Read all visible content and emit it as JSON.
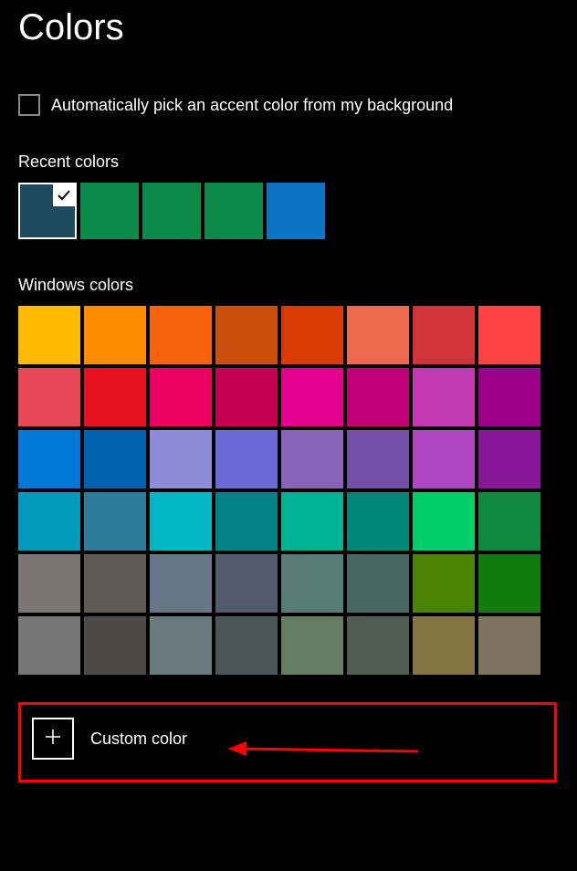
{
  "page_title": "Colors",
  "checkbox": {
    "label": "Automatically pick an accent color from my background",
    "checked": false
  },
  "recent_colors": {
    "label": "Recent colors",
    "items": [
      {
        "hex": "#1e4a5f",
        "selected": true
      },
      {
        "hex": "#0d8a4a",
        "selected": false
      },
      {
        "hex": "#0d8a4a",
        "selected": false
      },
      {
        "hex": "#0d8a4a",
        "selected": false
      },
      {
        "hex": "#0d73c2",
        "selected": false
      }
    ]
  },
  "windows_colors": {
    "label": "Windows colors",
    "items": [
      "#ffb900",
      "#ff8c00",
      "#f7630c",
      "#ca5010",
      "#da3b01",
      "#ef6950",
      "#d13438",
      "#ff4343",
      "#e74856",
      "#e81123",
      "#ea005e",
      "#c30052",
      "#e3008c",
      "#bf0077",
      "#c239b3",
      "#9a0089",
      "#0078d7",
      "#0063b1",
      "#8e8cd8",
      "#6b69d6",
      "#8764b8",
      "#744da9",
      "#b146c2",
      "#881798",
      "#0099bc",
      "#2d7d9a",
      "#00b7c3",
      "#038387",
      "#00b294",
      "#018574",
      "#00cc6a",
      "#10893e",
      "#7a7574",
      "#5d5a58",
      "#68768a",
      "#515c6b",
      "#567c73",
      "#486860",
      "#498205",
      "#107c10",
      "#767676",
      "#4c4a48",
      "#69797e",
      "#4a5459",
      "#647c64",
      "#525e54",
      "#847545",
      "#7e735f"
    ]
  },
  "custom_color": {
    "label": "Custom color"
  }
}
